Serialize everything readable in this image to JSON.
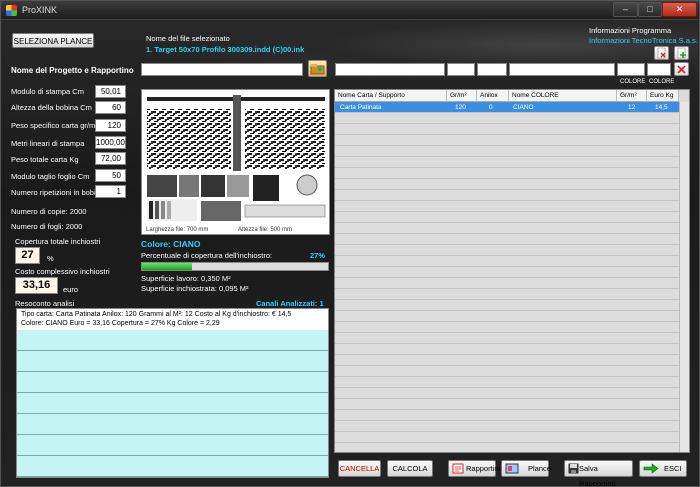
{
  "window": {
    "title": "ProXINK",
    "minimize": "–",
    "maximize": "□",
    "close": "✕"
  },
  "left": {
    "select_plates_button": "SELEZIONA PLANCE",
    "project_label": "Nome del Progetto e Rapportino",
    "fields": [
      {
        "label": "Modulo di stampa Cm",
        "value": "50,01"
      },
      {
        "label": "Altezza della bobina Cm",
        "value": "60"
      },
      {
        "label": "Peso specifico carta gr/m²",
        "value": "120"
      },
      {
        "label": "Metri lineari di stampa",
        "value": "1000,00"
      },
      {
        "label": "Peso totale carta Kg",
        "value": "72,00"
      },
      {
        "label": "Modulo taglio foglio Cm",
        "value": "50"
      },
      {
        "label": "Numero ripetizioni in bobina",
        "value": "1"
      }
    ],
    "copies": "Numero di copie: 2000",
    "sheets": "Numero di fogli: 2000",
    "coverage_label": "Copertura totale inchiostri",
    "coverage_value": "27",
    "coverage_unit": "%",
    "cost_label": "Costo complessivo inchiostri",
    "cost_value": "33,16",
    "cost_unit": "euro",
    "report_label": "Resoconto analisi"
  },
  "center": {
    "selected_file_label": "Nome del file selezionato",
    "selected_file": "1. Target 50x70 Profilo 300309.indd (C)00.ink",
    "width_caption": "Larghezza file: 700 mm",
    "height_caption": "Altezza file: 500 mm",
    "color_title": "Colore: CIANO",
    "coverage_pct_label": "Percentuale di copertura dell'inchiostro:",
    "coverage_pct_value": "27%",
    "coverage_fraction": 0.27,
    "work_surface": "Superficie lavoro: 0,350 M²",
    "inked_surface": "Superficie inchiostrata: 0,095 M²",
    "channels": "Canali Analizzati: 1"
  },
  "program_info": {
    "title": "Informazioni Programma",
    "company": "Informazioni TecnoTronica S.a.s."
  },
  "table": {
    "top_headers": [
      "COLORE",
      "COLORE"
    ],
    "columns": [
      "Nome Carta / Supporto",
      "Gr/m²",
      "Anilox",
      "Nome COLORE",
      "Gr/m²",
      "Euro Kg"
    ],
    "rows": [
      {
        "paper": "Carta Patinata",
        "grams": "120",
        "anilox": "0",
        "color": "CIANO",
        "color_grams": "12",
        "euro_kg": "14,5"
      }
    ]
  },
  "report": {
    "lines": [
      "Tipo carta: Carta Patinata   Anilox: 120   Grammi al M²: 12    Costo al Kg d'inchiostro: € 14,5",
      "Colore: CIANO  Euro = 33,16  Copertura = 27%  Kg Colore = 2,29"
    ]
  },
  "bottom": {
    "cancel": "CANCELLA",
    "calc": "CALCOLA",
    "reports": "Rapportini",
    "plates": "Plance",
    "save_report": "Salva Rapportino",
    "exit": "ESCI"
  },
  "colors": {
    "accent_cyan": "#2fd0ff",
    "selection": "#3c8fe0",
    "report_bg": "#c4f4f4",
    "progress": "#1ea31e"
  }
}
